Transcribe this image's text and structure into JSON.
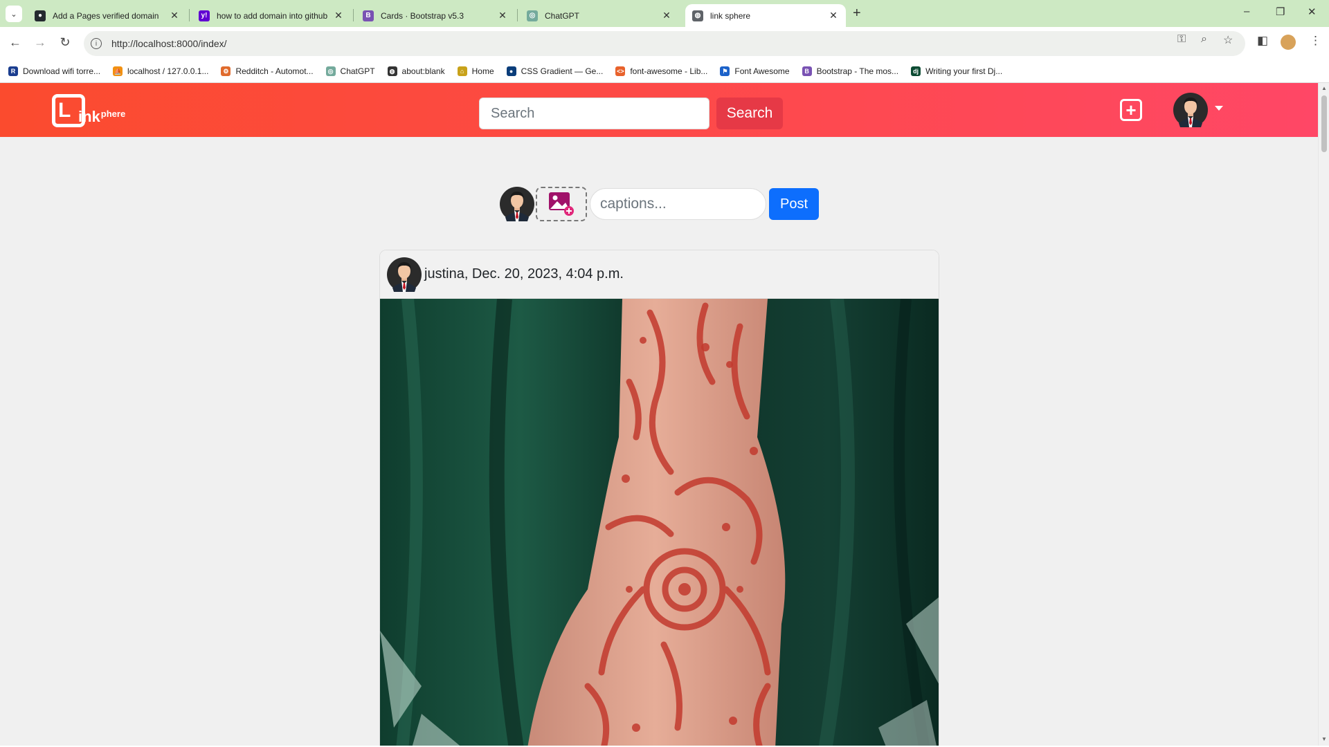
{
  "browser": {
    "tabs": [
      {
        "title": "Add a Pages verified domain",
        "icon": "github-icon",
        "color": "#24292f",
        "glyph": "●"
      },
      {
        "title": "how to add domain into github",
        "icon": "yahoo-icon",
        "color": "#6001d2",
        "glyph": "y!"
      },
      {
        "title": "Cards · Bootstrap v5.3",
        "icon": "bootstrap-icon",
        "color": "#7952b3",
        "glyph": "B"
      },
      {
        "title": "ChatGPT",
        "icon": "chatgpt-icon",
        "color": "#74aa9c",
        "glyph": "◎"
      },
      {
        "title": "link sphere",
        "icon": "globe-icon",
        "color": "#5f6368",
        "glyph": "◍"
      }
    ],
    "active_tab": 4,
    "url": "http://localhost:8000/index/",
    "bookmarks": [
      {
        "label": "Download wifi torre...",
        "icon": "r-icon",
        "color": "#1a3d8f",
        "glyph": "R"
      },
      {
        "label": "localhost / 127.0.0.1...",
        "icon": "phpmyadmin-icon",
        "color": "#f29111",
        "glyph": "⛵"
      },
      {
        "label": "Redditch - Automot...",
        "icon": "redditch-icon",
        "color": "#e06b2d",
        "glyph": "⚙"
      },
      {
        "label": "ChatGPT",
        "icon": "chatgpt-icon",
        "color": "#74aa9c",
        "glyph": "◎"
      },
      {
        "label": "about:blank",
        "icon": "globe-icon",
        "color": "#333333",
        "glyph": "◍"
      },
      {
        "label": "Home",
        "icon": "home-icon",
        "color": "#c8a21a",
        "glyph": "⌂"
      },
      {
        "label": "CSS Gradient — Ge...",
        "icon": "css-gradient-icon",
        "color": "#0a3d7a",
        "glyph": "●"
      },
      {
        "label": "font-awesome - Lib...",
        "icon": "code-icon",
        "color": "#e8622c",
        "glyph": "<>"
      },
      {
        "label": "Font Awesome",
        "icon": "flag-icon",
        "color": "#1c62c9",
        "glyph": "⚑"
      },
      {
        "label": "Bootstrap - The mos...",
        "icon": "bootstrap-icon",
        "color": "#7952b3",
        "glyph": "B"
      },
      {
        "label": "Writing your first Dj...",
        "icon": "django-icon",
        "color": "#0c4b33",
        "glyph": "dj"
      }
    ]
  },
  "navbar": {
    "logo_ink": "ink",
    "logo_rest": "phere",
    "search_placeholder": "Search",
    "search_button": "Search",
    "gradient_start": "#fb4b2e",
    "gradient_end": "#ff4766"
  },
  "composer": {
    "caption_placeholder": "captions...",
    "post_button": "Post"
  },
  "post": {
    "author_line": "justina, Dec. 20, 2023, 4:04 p.m."
  }
}
